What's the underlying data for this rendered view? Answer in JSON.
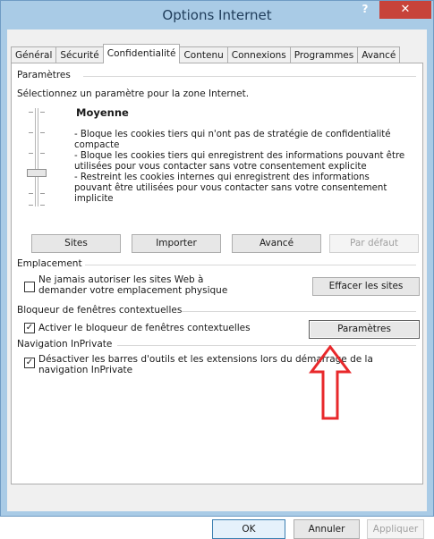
{
  "window": {
    "title": "Options Internet",
    "help": "?",
    "close": "✕"
  },
  "tabs": [
    "Général",
    "Sécurité",
    "Confidentialité",
    "Contenu",
    "Connexions",
    "Programmes",
    "Avancé"
  ],
  "parametres": {
    "group": "Paramètres",
    "instruction": "Sélectionnez un paramètre pour la zone Internet.",
    "level": "Moyenne",
    "description": [
      "- Bloque les cookies tiers qui n'ont pas de stratégie de confidentialité compacte",
      "- Bloque les cookies tiers qui enregistrent des informations pouvant être utilisées pour vous contacter sans votre consentement explicite",
      "- Restreint les cookies internes qui enregistrent des informations pouvant être utilisées pour vous contacter sans votre consentement implicite"
    ],
    "buttons": {
      "sites": "Sites",
      "importer": "Importer",
      "avance": "Avancé",
      "par_defaut": "Par défaut"
    }
  },
  "emplacement": {
    "group": "Emplacement",
    "checkbox_label": "Ne jamais autoriser les sites Web à demander votre emplacement physique",
    "checked": false,
    "button": "Effacer les sites"
  },
  "bloqueur": {
    "group": "Bloqueur de fenêtres contextuelles",
    "checkbox_label": "Activer le bloqueur de fenêtres contextuelles",
    "checked": true,
    "button": "Paramètres"
  },
  "inprivate": {
    "group": "Navigation InPrivate",
    "checkbox_label": "Désactiver les barres d'outils et les extensions lors du démarrage de la navigation InPrivate",
    "checked": true
  },
  "dialog_buttons": {
    "ok": "OK",
    "annuler": "Annuler",
    "appliquer": "Appliquer"
  },
  "colors": {
    "titlebar": "#a9cbe6",
    "close": "#c7433a",
    "arrow": "#e8282b"
  }
}
